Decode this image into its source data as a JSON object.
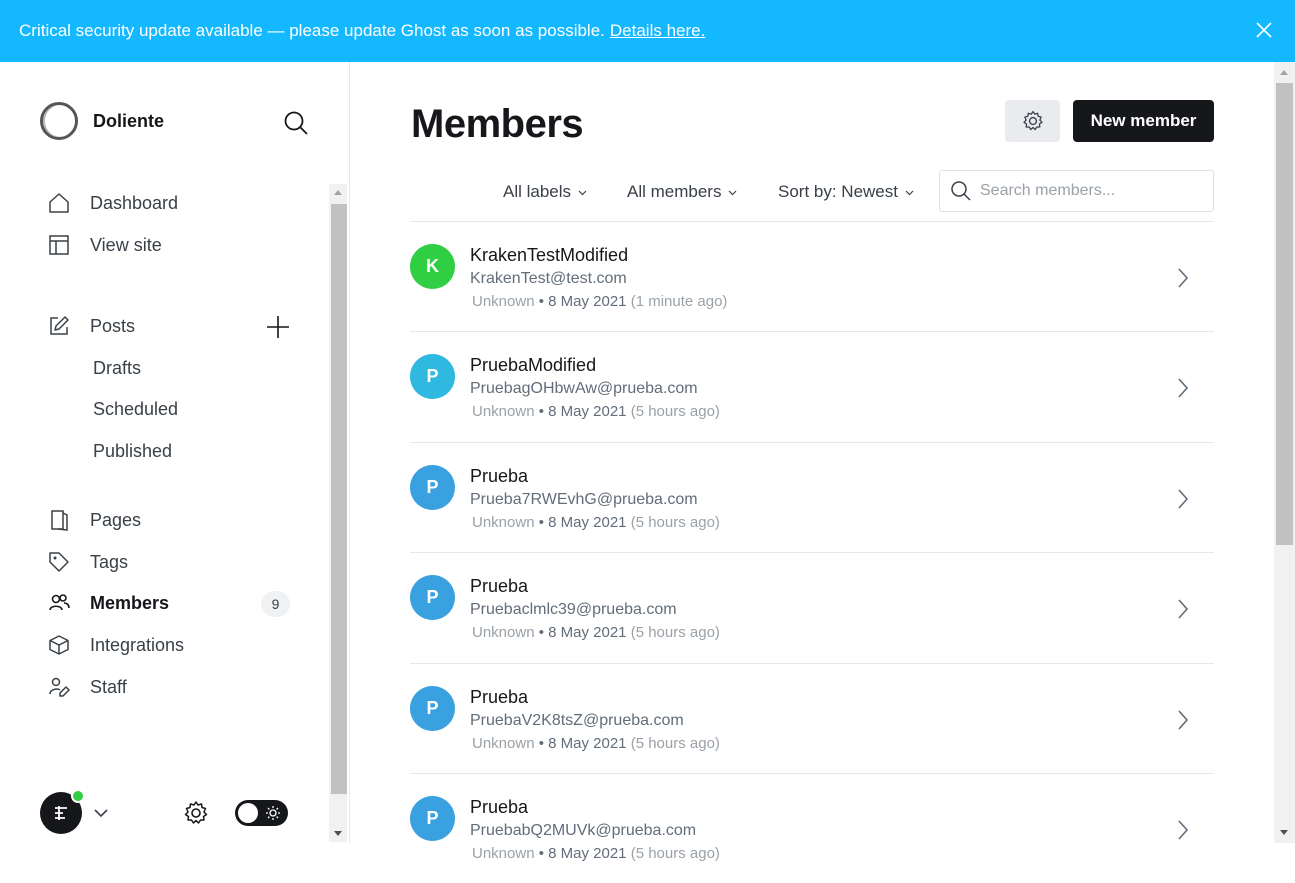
{
  "banner": {
    "message": "Critical security update available — please update Ghost as soon as possible.",
    "link": "Details here.",
    "bg_color": "#14b8ff"
  },
  "sidebar": {
    "site_name": "Doliente",
    "nav": [
      {
        "label": "Dashboard",
        "icon": "home-icon"
      },
      {
        "label": "View site",
        "icon": "layout-icon"
      }
    ],
    "posts": {
      "label": "Posts",
      "icon": "edit-icon",
      "sub": [
        "Drafts",
        "Scheduled",
        "Published"
      ]
    },
    "nav2": [
      {
        "label": "Pages",
        "icon": "page-icon"
      },
      {
        "label": "Tags",
        "icon": "tag-icon"
      },
      {
        "label": "Members",
        "icon": "members-icon",
        "active": true,
        "count": "9"
      },
      {
        "label": "Integrations",
        "icon": "box-icon"
      },
      {
        "label": "Staff",
        "icon": "staff-icon"
      }
    ]
  },
  "main": {
    "title": "Members",
    "new_button": "New member",
    "filters": {
      "labels": "All labels",
      "members": "All members",
      "sort": "Sort by: Newest"
    },
    "search_placeholder": "Search members...",
    "members": [
      {
        "initial": "K",
        "name": "KrakenTestModified",
        "email": "KrakenTest@test.com",
        "status": "Unknown",
        "date": "8 May 2021",
        "ago": "(1 minute ago)",
        "color": "#30cf43"
      },
      {
        "initial": "P",
        "name": "PruebaModified",
        "email": "PruebagOHbwAw@prueba.com",
        "status": "Unknown",
        "date": "8 May 2021",
        "ago": "(5 hours ago)",
        "color": "#2fb8e0"
      },
      {
        "initial": "P",
        "name": "Prueba",
        "email": "Prueba7RWEvhG@prueba.com",
        "status": "Unknown",
        "date": "8 May 2021",
        "ago": "(5 hours ago)",
        "color": "#3aa1e0"
      },
      {
        "initial": "P",
        "name": "Prueba",
        "email": "Pruebaclmlc39@prueba.com",
        "status": "Unknown",
        "date": "8 May 2021",
        "ago": "(5 hours ago)",
        "color": "#3aa1e0"
      },
      {
        "initial": "P",
        "name": "Prueba",
        "email": "PruebaV2K8tsZ@prueba.com",
        "status": "Unknown",
        "date": "8 May 2021",
        "ago": "(5 hours ago)",
        "color": "#3aa1e0"
      },
      {
        "initial": "P",
        "name": "Prueba",
        "email": "PruebabQ2MUVk@prueba.com",
        "status": "Unknown",
        "date": "8 May 2021",
        "ago": "(5 hours ago)",
        "color": "#3aa1e0"
      }
    ]
  }
}
